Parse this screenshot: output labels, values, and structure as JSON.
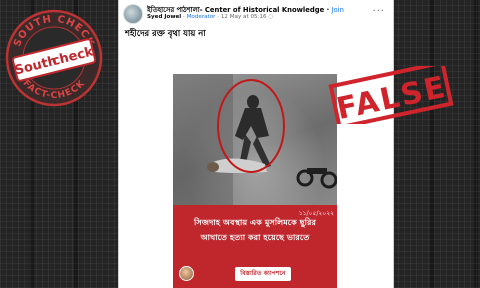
{
  "post": {
    "group_name": "ইতিহাসের পাঠশালা- Center of Historical Knowledge",
    "join_label": "Join",
    "poster_name": "Syed Jowel",
    "role_badge": "Moderator",
    "meta_time": "12 May at 05:16",
    "more_options_label": "···",
    "caption": "শহীদের রক্ত বৃথা যায় না"
  },
  "post_image": {
    "overlay_line_1": "সিজদাহ অবস্থায় এক মুসলিমকে ছুরির",
    "overlay_line_2": "আঘাতে হত্যা করা হয়েছে ভারতে",
    "date": "১১/০৫/২০২২",
    "promo_label": "বিস্তারিত ক্যাপশনে"
  },
  "logo": {
    "top_text": "SOUTH CHECK",
    "bottom_text": "FACT-CHECK",
    "wordmark_1": "South",
    "wordmark_2": "check"
  },
  "verdict": {
    "label": "FALSE"
  },
  "colors": {
    "fb_link": "#1877f2",
    "band_red": "#c0272d",
    "stamp_red": "#d0242c",
    "background": "#242424"
  }
}
